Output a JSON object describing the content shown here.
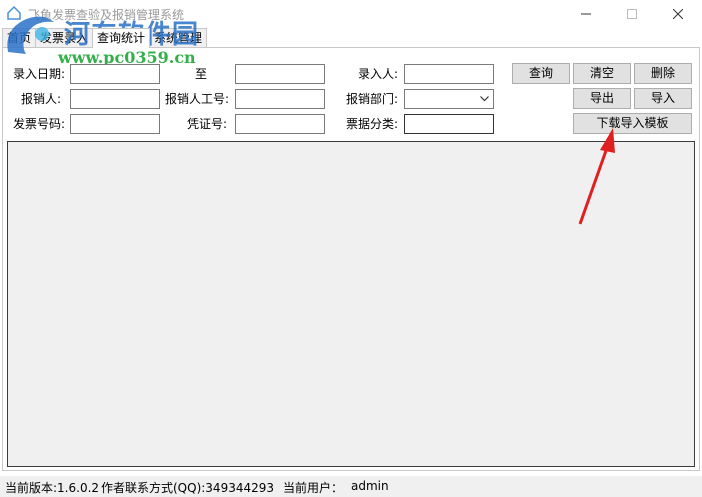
{
  "window": {
    "title": "飞鱼发票查验及报销管理系统"
  },
  "watermark": {
    "site_name": "河东软件园",
    "url": "www.pc0359.cn"
  },
  "tabs": [
    {
      "label": "首页"
    },
    {
      "label": "发票录入"
    },
    {
      "label": "查询统计",
      "active": true
    },
    {
      "label": "系统管理"
    }
  ],
  "form": {
    "entry_date_label": "录入日期:",
    "to_label": "至",
    "entry_person_label": "录入人:",
    "reimburser_label": "报销人:",
    "reimburser_id_label": "报销人工号:",
    "department_label": "报销部门:",
    "invoice_no_label": "发票号码:",
    "voucher_no_label": "凭证号:",
    "doc_category_label": "票据分类:",
    "entry_date_from": "",
    "entry_date_to": "",
    "entry_person": "",
    "reimburser": "",
    "reimburser_id": "",
    "department": "",
    "invoice_no": "",
    "voucher_no": "",
    "doc_category": ""
  },
  "buttons": {
    "query": "查询",
    "clear": "清空",
    "delete": "删除",
    "export": "导出",
    "import": "导入",
    "download_template": "下载导入模板"
  },
  "statusbar": {
    "version": "当前版本:1.6.0.2",
    "contact": "作者联系方式(QQ):349344293",
    "current_user_label": "当前用户：",
    "current_user": "admin"
  },
  "colors": {
    "annotation_arrow": "#e02020",
    "watermark_blue": "#2a72c8",
    "watermark_green": "#33b04a"
  }
}
